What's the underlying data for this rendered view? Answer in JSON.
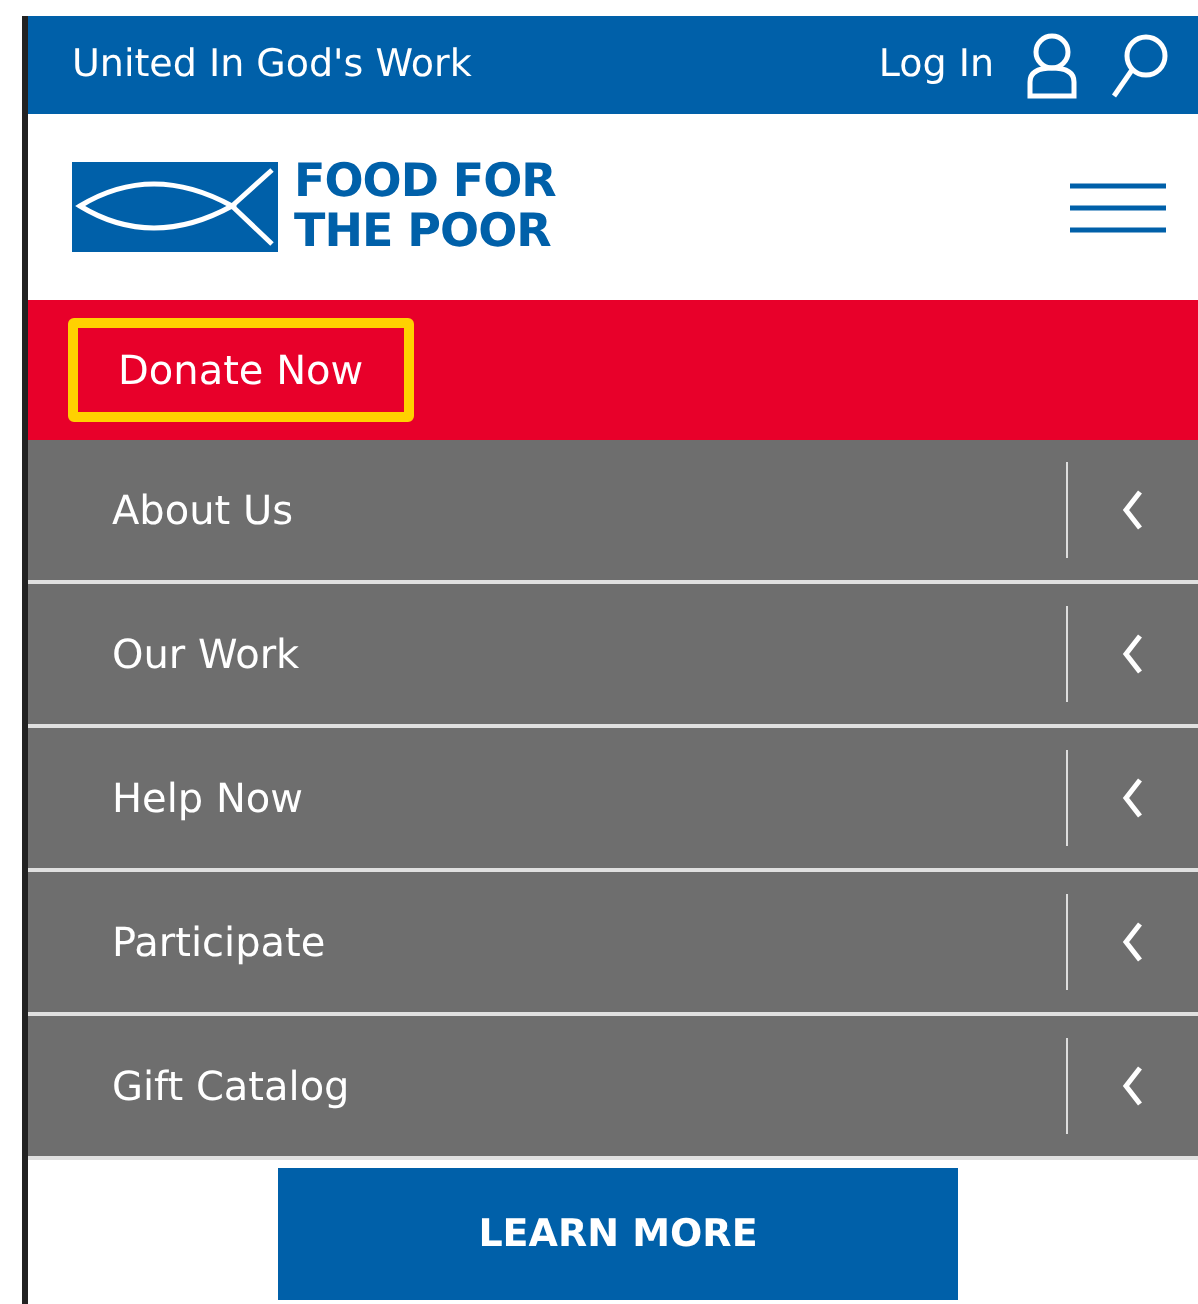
{
  "top_bar": {
    "tagline": "United In God's Work",
    "login": "Log In"
  },
  "logo": {
    "line_1": "FOOD FOR",
    "line_2": "THE POOR"
  },
  "donate": {
    "label": "Donate Now",
    "highlighted": true
  },
  "menu_items": [
    {
      "label": "About Us",
      "expanded": false
    },
    {
      "label": "Our Work",
      "expanded": false
    },
    {
      "label": "Help Now",
      "expanded": false
    },
    {
      "label": "Participate",
      "expanded": false
    },
    {
      "label": "Gift Catalog",
      "expanded": false
    }
  ],
  "cta_button": "LEARN MORE"
}
